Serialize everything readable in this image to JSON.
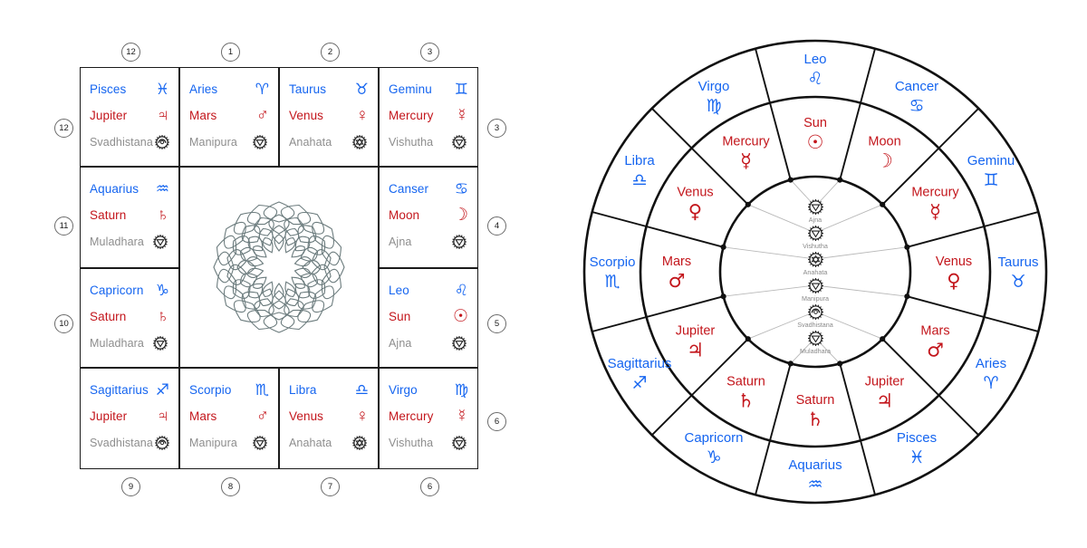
{
  "colors": {
    "sign": "#1565f0",
    "planet": "#c3161c",
    "chakra": "#8d8d8d",
    "line": "#111111",
    "mandala": "#6b7b7d"
  },
  "square_chart": {
    "title": "square-astrology-chart",
    "house_markers_top": [
      "12",
      "1",
      "2",
      "3"
    ],
    "house_markers_right": [
      "3",
      "4",
      "5",
      "6"
    ],
    "house_markers_bottom": [
      "9",
      "8",
      "7",
      "6"
    ],
    "house_markers_left": [
      "12",
      "11",
      "10"
    ],
    "center_icon": "sahasrara-lotus-mandala",
    "cells": [
      {
        "pos": "top-1",
        "sign": "Pisces",
        "sign_glyph": "♓",
        "planet": "Jupiter",
        "planet_glyph": "♃",
        "chakra": "Svadhistana",
        "chakra_icon": "svadhistana-chakra-icon"
      },
      {
        "pos": "top-2",
        "sign": "Aries",
        "sign_glyph": "♈",
        "planet": "Mars",
        "planet_glyph": "♂",
        "chakra": "Manipura",
        "chakra_icon": "manipura-chakra-icon"
      },
      {
        "pos": "top-3",
        "sign": "Taurus",
        "sign_glyph": "♉",
        "planet": "Venus",
        "planet_glyph": "♀",
        "chakra": "Anahata",
        "chakra_icon": "anahata-chakra-icon"
      },
      {
        "pos": "top-4",
        "sign": "Geminu",
        "sign_glyph": "♊",
        "planet": "Mercury",
        "planet_glyph": "☿",
        "chakra": "Vishutha",
        "chakra_icon": "vishutha-chakra-icon"
      },
      {
        "pos": "left-2",
        "sign": "Aquarius",
        "sign_glyph": "♒",
        "planet": "Saturn",
        "planet_glyph": "♄",
        "chakra": "Muladhara",
        "chakra_icon": "muladhara-chakra-icon"
      },
      {
        "pos": "left-3",
        "sign": "Capricorn",
        "sign_glyph": "♑",
        "planet": "Saturn",
        "planet_glyph": "♄",
        "chakra": "Muladhara",
        "chakra_icon": "muladhara-chakra-icon"
      },
      {
        "pos": "right-2",
        "sign": "Canser",
        "sign_glyph": "♋",
        "planet": "Moon",
        "planet_glyph": "☽",
        "chakra": "Ajna",
        "chakra_icon": "ajna-chakra-icon"
      },
      {
        "pos": "right-3",
        "sign": "Leo",
        "sign_glyph": "♌",
        "planet": "Sun",
        "planet_glyph": "☉",
        "chakra": "Ajna",
        "chakra_icon": "ajna-chakra-icon"
      },
      {
        "pos": "bot-1",
        "sign": "Sagittarius",
        "sign_glyph": "♐",
        "planet": "Jupiter",
        "planet_glyph": "♃",
        "chakra": "Svadhistana",
        "chakra_icon": "svadhistana-chakra-icon"
      },
      {
        "pos": "bot-2",
        "sign": "Scorpio",
        "sign_glyph": "♏",
        "planet": "Mars",
        "planet_glyph": "♂",
        "chakra": "Manipura",
        "chakra_icon": "manipura-chakra-icon"
      },
      {
        "pos": "bot-3",
        "sign": "Libra",
        "sign_glyph": "♎",
        "planet": "Venus",
        "planet_glyph": "♀",
        "chakra": "Anahata",
        "chakra_icon": "anahata-chakra-icon"
      },
      {
        "pos": "bot-4",
        "sign": "Virgo",
        "sign_glyph": "♍",
        "planet": "Mercury",
        "planet_glyph": "☿",
        "chakra": "Vishutha",
        "chakra_icon": "vishutha-chakra-icon"
      }
    ]
  },
  "circle_chart": {
    "title": "circular-zodiac-wheel",
    "outer_ring_signs": [
      {
        "name": "Cancer",
        "glyph": "♋",
        "angle_deg": -60
      },
      {
        "name": "Geminu",
        "glyph": "♊",
        "angle_deg": -30
      },
      {
        "name": "Taurus",
        "glyph": "♉",
        "angle_deg": 0
      },
      {
        "name": "Aries",
        "glyph": "♈",
        "angle_deg": 30
      },
      {
        "name": "Pisces",
        "glyph": "♓",
        "angle_deg": 60
      },
      {
        "name": "Aquarius",
        "glyph": "♒",
        "angle_deg": 90
      },
      {
        "name": "Capricorn",
        "glyph": "♑",
        "angle_deg": 120
      },
      {
        "name": "Sagittarius",
        "glyph": "♐",
        "angle_deg": 150
      },
      {
        "name": "Scorpio",
        "glyph": "♏",
        "angle_deg": 180
      },
      {
        "name": "Libra",
        "glyph": "♎",
        "angle_deg": 210
      },
      {
        "name": "Virgo",
        "glyph": "♍",
        "angle_deg": 240
      },
      {
        "name": "Leo",
        "glyph": "♌",
        "angle_deg": 270
      }
    ],
    "inner_ring_planets": [
      {
        "name": "Moon",
        "glyph": "☽",
        "angle_deg": -60
      },
      {
        "name": "Mercury",
        "glyph": "☿",
        "angle_deg": -30
      },
      {
        "name": "Venus",
        "glyph": "♀",
        "angle_deg": 0
      },
      {
        "name": "Mars",
        "glyph": "♂",
        "angle_deg": 30
      },
      {
        "name": "Jupiter",
        "glyph": "♃",
        "angle_deg": 60
      },
      {
        "name": "Saturn",
        "glyph": "♄",
        "angle_deg": 90
      },
      {
        "name": "Saturn",
        "glyph": "♄",
        "angle_deg": 120
      },
      {
        "name": "Jupiter",
        "glyph": "♃",
        "angle_deg": 150
      },
      {
        "name": "Mars",
        "glyph": "♂",
        "angle_deg": 180
      },
      {
        "name": "Venus",
        "glyph": "♀",
        "angle_deg": 210
      },
      {
        "name": "Mercury",
        "glyph": "☿",
        "angle_deg": 240
      },
      {
        "name": "Sun",
        "glyph": "☉",
        "angle_deg": 270
      }
    ],
    "center_chakras": [
      {
        "name": "Ajna",
        "icon": "ajna-chakra-icon"
      },
      {
        "name": "Vishutha",
        "icon": "vishutha-chakra-icon"
      },
      {
        "name": "Anahata",
        "icon": "anahata-chakra-icon"
      },
      {
        "name": "Manipura",
        "icon": "manipura-chakra-icon"
      },
      {
        "name": "Svadhistana",
        "icon": "svadhistana-chakra-icon"
      },
      {
        "name": "Muladhara",
        "icon": "muladhara-chakra-icon"
      }
    ]
  }
}
